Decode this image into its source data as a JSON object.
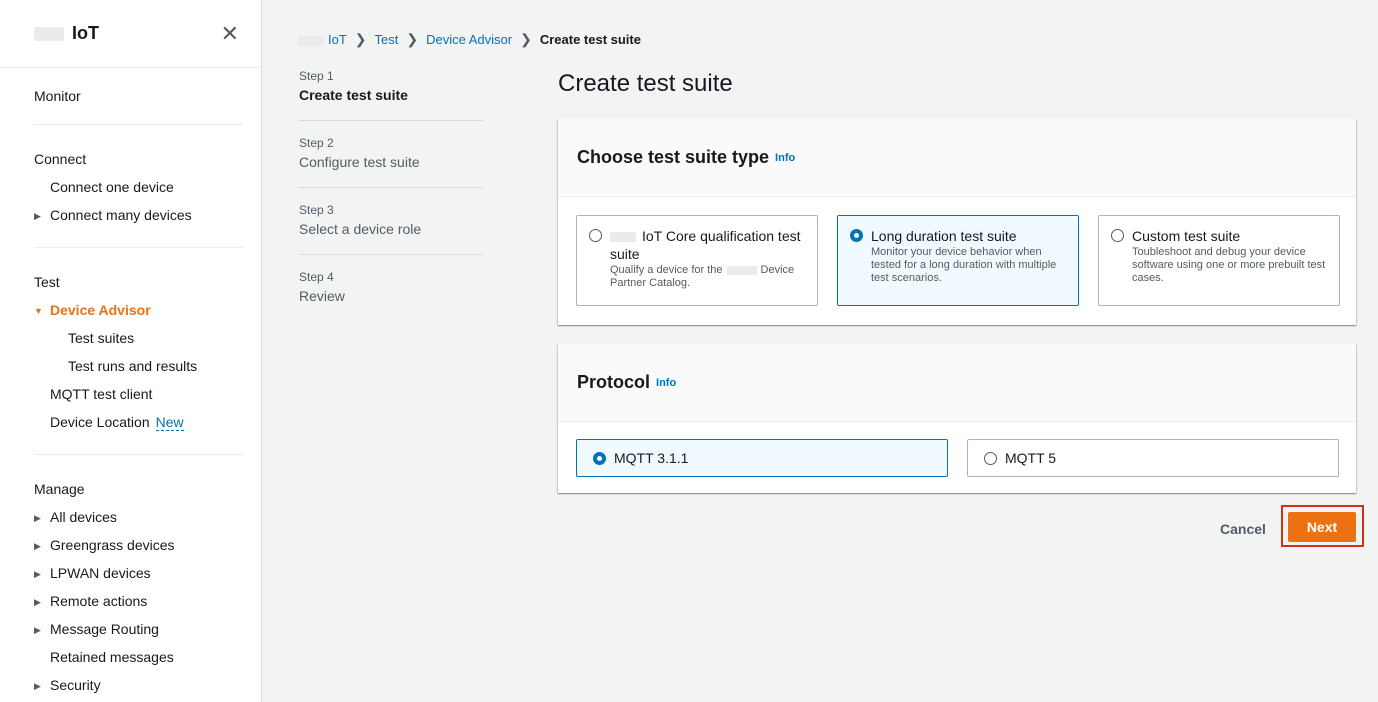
{
  "sidebar": {
    "title": "IoT",
    "close_icon": "close-icon",
    "sections": [
      {
        "heading": "Monitor",
        "items": []
      },
      {
        "heading": "Connect",
        "items": [
          {
            "label": "Connect one device",
            "level": 1,
            "arrow": ""
          },
          {
            "label": "Connect many devices",
            "level": 0,
            "arrow": "▶"
          }
        ]
      },
      {
        "heading": "Test",
        "items": [
          {
            "label": "Device Advisor",
            "level": 0,
            "arrow": "▼",
            "active": true
          },
          {
            "label": "Test suites",
            "level": 2,
            "arrow": ""
          },
          {
            "label": "Test runs and results",
            "level": 2,
            "arrow": ""
          },
          {
            "label": "MQTT test client",
            "level": 1,
            "arrow": ""
          },
          {
            "label": "Device Location",
            "level": 1,
            "arrow": "",
            "badge": "New"
          }
        ]
      },
      {
        "heading": "Manage",
        "items": [
          {
            "label": "All devices",
            "level": 0,
            "arrow": "▶"
          },
          {
            "label": "Greengrass devices",
            "level": 0,
            "arrow": "▶"
          },
          {
            "label": "LPWAN devices",
            "level": 0,
            "arrow": "▶"
          },
          {
            "label": "Remote actions",
            "level": 0,
            "arrow": "▶"
          },
          {
            "label": "Message Routing",
            "level": 0,
            "arrow": "▶"
          },
          {
            "label": "Retained messages",
            "level": 1,
            "arrow": ""
          },
          {
            "label": "Security",
            "level": 0,
            "arrow": "▶"
          }
        ]
      }
    ]
  },
  "breadcrumb": {
    "items": [
      "IoT",
      "Test",
      "Device Advisor"
    ],
    "current": "Create test suite",
    "separator": "❯"
  },
  "steps": [
    {
      "num": "Step 1",
      "title": "Create test suite",
      "active": true
    },
    {
      "num": "Step 2",
      "title": "Configure test suite"
    },
    {
      "num": "Step 3",
      "title": "Select a device role"
    },
    {
      "num": "Step 4",
      "title": "Review"
    }
  ],
  "page_title": "Create test suite",
  "suite_type": {
    "heading": "Choose test suite type",
    "info": "Info",
    "options": [
      {
        "title": "IoT Core qualification test suite",
        "desc_a": "Qualify a device for the",
        "desc_b": "Device Partner Catalog.",
        "selected": false
      },
      {
        "title": "Long duration test suite",
        "desc": "Monitor your device behavior when tested for a long duration with multiple test scenarios.",
        "selected": true
      },
      {
        "title": "Custom test suite",
        "desc": "Toubleshoot and debug your device software using one or more prebuilt test cases.",
        "selected": false
      }
    ]
  },
  "protocol": {
    "heading": "Protocol",
    "info": "Info",
    "options": [
      {
        "label": "MQTT 3.1.1",
        "selected": true
      },
      {
        "label": "MQTT 5",
        "selected": false
      }
    ]
  },
  "actions": {
    "cancel": "Cancel",
    "next": "Next"
  },
  "colors": {
    "accent": "#ec7211",
    "link": "#0073bb",
    "highlight": "#d13212"
  }
}
